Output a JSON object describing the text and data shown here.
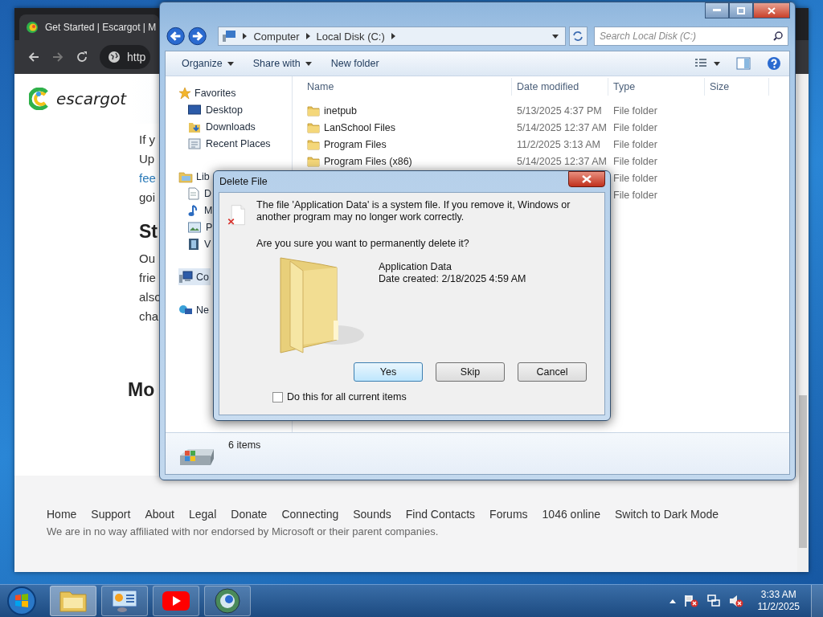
{
  "browser": {
    "tab_title": "Get Started | Escargot | M",
    "address": "http",
    "logo_text": "escargot",
    "content": [
      {
        "kind": "line",
        "text": "If y"
      },
      {
        "kind": "line",
        "text": "Up"
      },
      {
        "kind": "link",
        "text": "fee"
      },
      {
        "kind": "line",
        "text": "goi"
      },
      {
        "kind": "heading",
        "text": "St"
      },
      {
        "kind": "line",
        "text": "Ou"
      },
      {
        "kind": "line",
        "text": "frie"
      },
      {
        "kind": "line",
        "text": "also"
      },
      {
        "kind": "line",
        "text": "cha"
      },
      {
        "kind": "section",
        "text": "Mo"
      }
    ],
    "footer": {
      "links": [
        "Home",
        "Support",
        "About",
        "Legal",
        "Donate",
        "Connecting",
        "Sounds",
        "Find Contacts",
        "Forums",
        "1046 online",
        "Switch to Dark Mode"
      ],
      "disclaimer": "We are in no way affiliated with nor endorsed by Microsoft or their parent companies."
    }
  },
  "explorer": {
    "breadcrumb": [
      "Computer",
      "Local Disk (C:)"
    ],
    "search": {
      "placeholder": "Search Local Disk (C:)"
    },
    "commands": [
      {
        "label": "Organize",
        "menu": true
      },
      {
        "label": "Share with",
        "menu": true
      },
      {
        "label": "New folder",
        "menu": false
      }
    ],
    "nav": [
      {
        "kind": "group",
        "text": "Favorites",
        "selected": false
      },
      {
        "kind": "item",
        "text": "Desktop",
        "selected": false
      },
      {
        "kind": "item",
        "text": "Downloads",
        "selected": false
      },
      {
        "kind": "item",
        "text": "Recent Places",
        "selected": false
      },
      {
        "kind": "group",
        "text": "Lib",
        "selected": false
      },
      {
        "kind": "item",
        "text": "D",
        "selected": false
      },
      {
        "kind": "item",
        "text": "M",
        "selected": false
      },
      {
        "kind": "item",
        "text": "P",
        "selected": false
      },
      {
        "kind": "item",
        "text": "V",
        "selected": false
      },
      {
        "kind": "group",
        "text": "Co",
        "selected": true
      },
      {
        "kind": "group",
        "text": "Ne",
        "selected": false
      }
    ],
    "columns": [
      "Name",
      "Date modified",
      "Type",
      "Size"
    ],
    "rows": [
      {
        "name": "inetpub",
        "date": "5/13/2025 4:37 PM",
        "type": "File folder"
      },
      {
        "name": "LanSchool Files",
        "date": "5/14/2025 12:37 AM",
        "type": "File folder"
      },
      {
        "name": "Program Files",
        "date": "11/2/2025 3:13 AM",
        "type": "File folder"
      },
      {
        "name": "Program Files (x86)",
        "date": "5/14/2025 12:37 AM",
        "type": "File folder"
      },
      {
        "type": "File folder"
      },
      {
        "type": "File folder"
      }
    ],
    "status": "6 items"
  },
  "dialog": {
    "title": "Delete File",
    "message": "The file 'Application Data' is a system file. If you remove it, Windows or another program may no longer work correctly.",
    "question": "Are you sure you want to permanently delete it?",
    "item_name": "Application Data",
    "item_date": "Date created: 2/18/2025 4:59 AM",
    "buttons": [
      {
        "label": "Yes",
        "selected": true
      },
      {
        "label": "Skip",
        "selected": false
      },
      {
        "label": "Cancel",
        "selected": false
      }
    ],
    "checkbox": {
      "label": "Do this for all current items",
      "checked": false
    }
  },
  "taskbar": {
    "apps": [
      {
        "kind": "folder",
        "active": true
      },
      {
        "kind": "control-panel",
        "active": false
      },
      {
        "kind": "youtube",
        "active": false
      },
      {
        "kind": "browser",
        "active": false
      }
    ],
    "time": "3:33 AM",
    "date": "11/2/2025"
  }
}
